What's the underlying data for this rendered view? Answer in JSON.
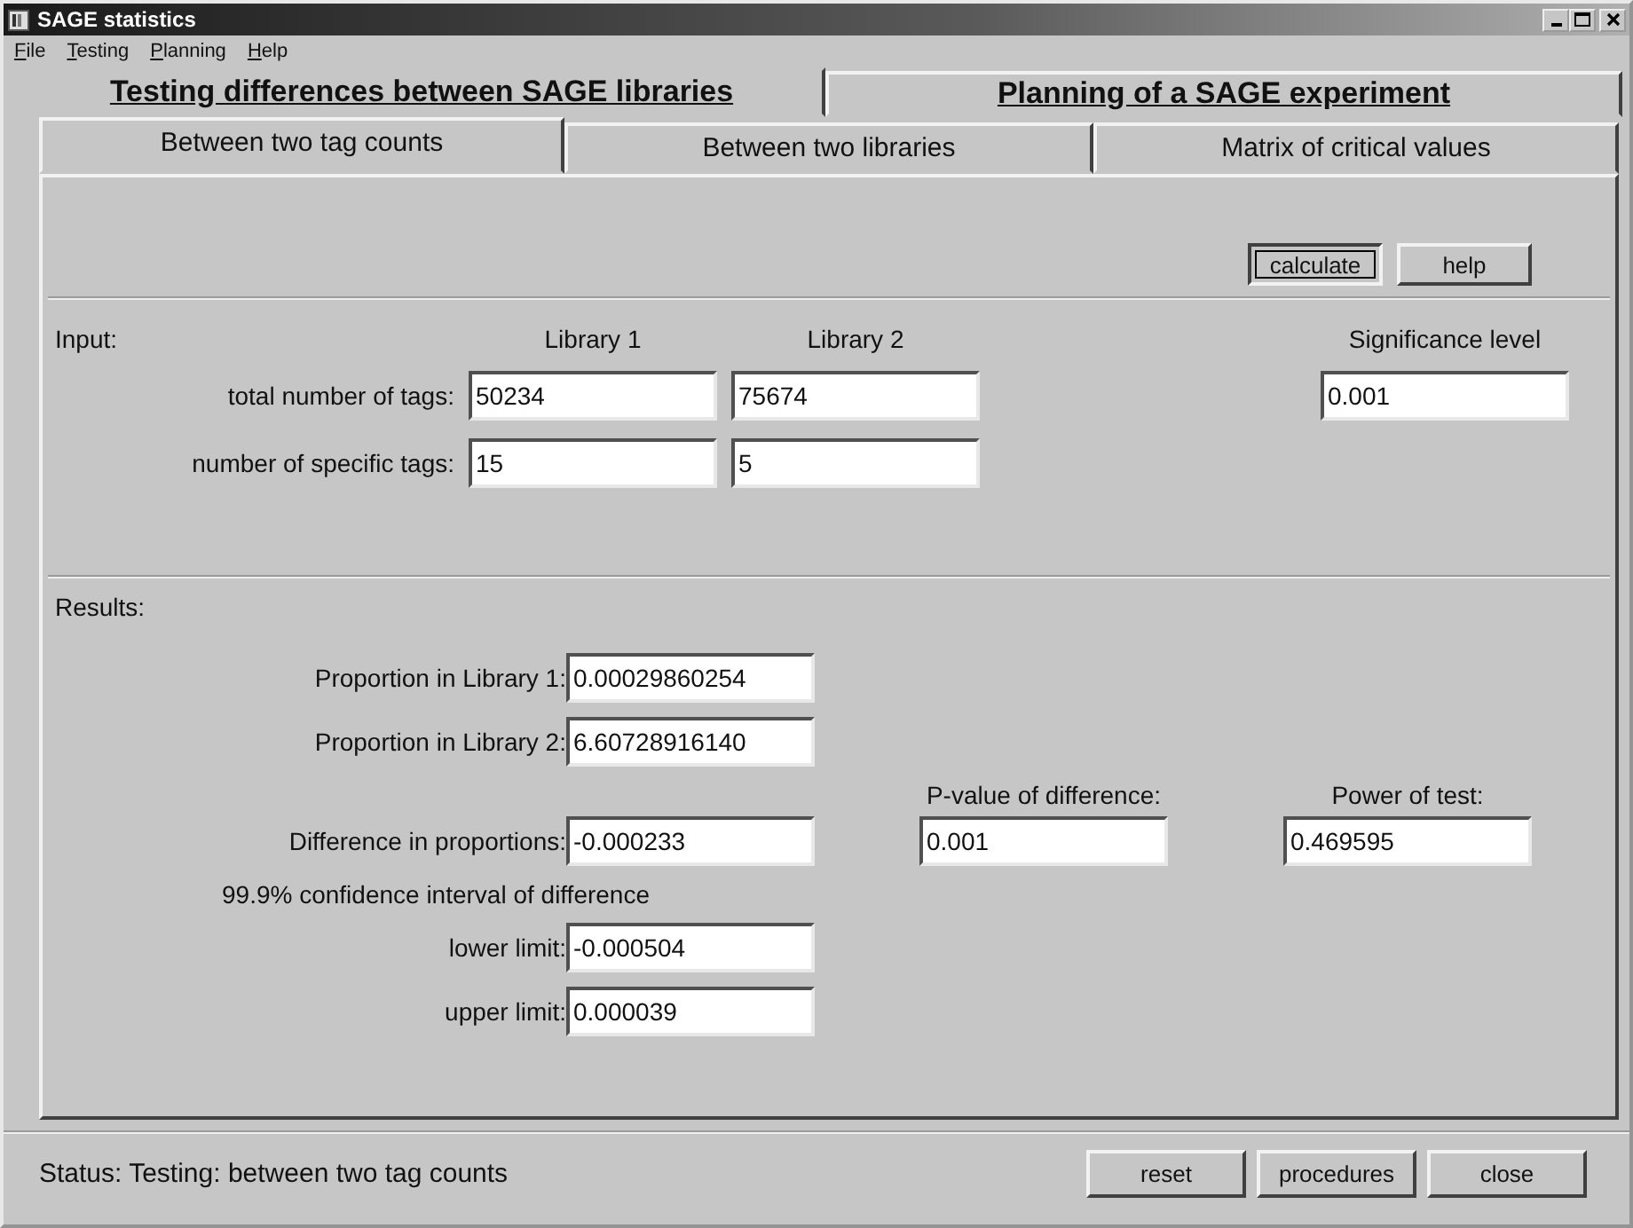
{
  "window": {
    "title": "SAGE statistics"
  },
  "menu": [
    {
      "label": "File"
    },
    {
      "label": "Testing"
    },
    {
      "label": "Planning"
    },
    {
      "label": "Help"
    }
  ],
  "main_tabs": [
    {
      "label": "Testing differences between SAGE libraries",
      "selected": true
    },
    {
      "label": "Planning of a SAGE experiment",
      "selected": false
    }
  ],
  "sub_tabs": [
    {
      "label": "Between two tag counts",
      "selected": true
    },
    {
      "label": "Between two libraries",
      "selected": false
    },
    {
      "label": "Matrix of critical values",
      "selected": false
    }
  ],
  "toolbar_buttons": [
    {
      "label": "calculate",
      "focused": true
    },
    {
      "label": "help",
      "focused": false
    }
  ],
  "input": {
    "heading": "Input:",
    "columns": [
      "Library 1",
      "Library 2"
    ],
    "rows": [
      {
        "label": "total number of tags:",
        "values": [
          "50234",
          "75674"
        ]
      },
      {
        "label": "number of specific tags:",
        "values": [
          "15",
          "5"
        ]
      }
    ],
    "significance": {
      "label": "Significance level",
      "value": "0.001"
    }
  },
  "results": {
    "heading": "Results:",
    "proportions": [
      {
        "label": "Proportion in Library 1:",
        "value": "0.00029860254"
      },
      {
        "label": "Proportion in Library 2:",
        "value": "6.60728916140"
      }
    ],
    "difference": {
      "label": "Difference in proportions:",
      "value": "-0.000233"
    },
    "p_value": {
      "label": "P-value of difference:",
      "value": "0.001"
    },
    "power": {
      "label": "Power of test:",
      "value": "0.469595"
    },
    "interval": {
      "caption": "99.9% confidence interval of difference",
      "limits": [
        {
          "label": "lower limit:",
          "value": "-0.000504"
        },
        {
          "label": "upper limit:",
          "value": "0.000039"
        }
      ]
    }
  },
  "status": {
    "text": "Status: Testing: between two tag counts"
  },
  "status_buttons": [
    {
      "label": "reset"
    },
    {
      "label": "procedures"
    },
    {
      "label": "close"
    }
  ]
}
